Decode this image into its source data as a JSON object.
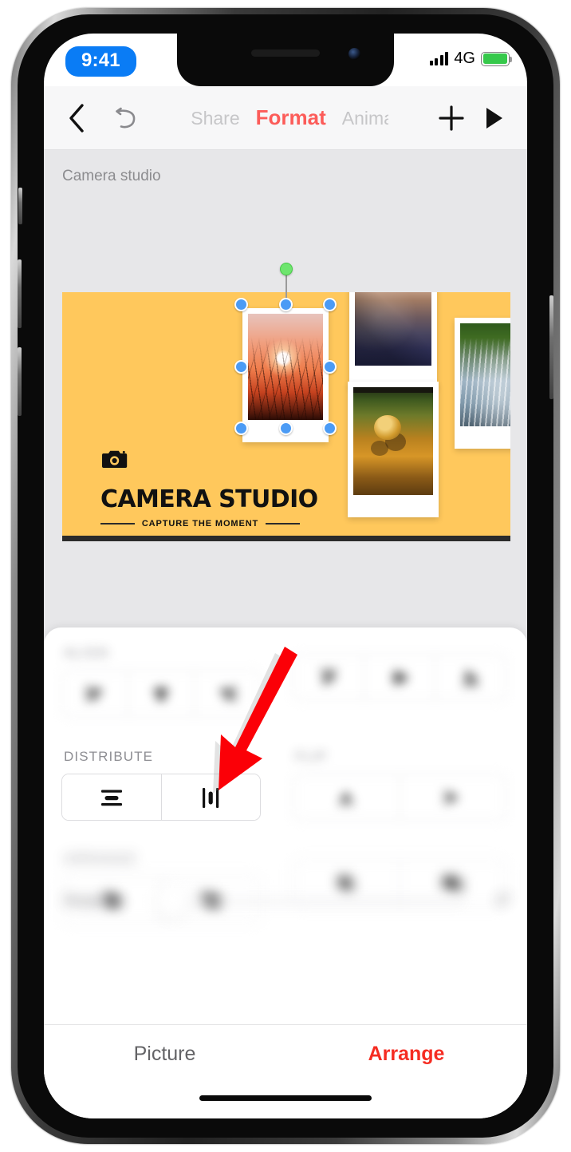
{
  "status_bar": {
    "time": "9:41",
    "network": "4G",
    "signal_icon": "signal-bars-icon",
    "battery_icon": "battery-full-icon"
  },
  "toolbar": {
    "back_icon": "chevron-left-icon",
    "undo_icon": "undo-arrow-icon",
    "add_icon": "plus-icon",
    "play_icon": "play-triangle-icon",
    "tabs": [
      {
        "label": "Share",
        "active": false
      },
      {
        "label": "Format",
        "active": true
      },
      {
        "label": "Animat",
        "active": false
      }
    ]
  },
  "canvas": {
    "document_name": "Camera studio",
    "slide": {
      "background_color": "#FFC85C",
      "title": "CAMERA STUDIO",
      "subtitle": "CAPTURE THE MOMENT",
      "logo_icon": "camera-icon",
      "photos": [
        {
          "name": "sunset-grass-photo",
          "selected": true
        },
        {
          "name": "mountain-photo",
          "selected": false
        },
        {
          "name": "spider-photo",
          "selected": false
        },
        {
          "name": "waterfall-photo",
          "selected": false
        }
      ]
    },
    "selection": {
      "rotation_handle_color": "#6ee56e",
      "handle_color": "#4b9bf5",
      "handle_count": 8
    }
  },
  "panel": {
    "sections": [
      {
        "label": "ALIGN",
        "blurred": true,
        "buttons": [
          {
            "icon": "align-left-icon"
          },
          {
            "icon": "align-center-horizontal-icon"
          },
          {
            "icon": "align-right-icon"
          }
        ]
      },
      {
        "label": "",
        "blurred": true,
        "buttons": [
          {
            "icon": "align-top-icon"
          },
          {
            "icon": "align-middle-vertical-icon"
          },
          {
            "icon": "align-bottom-icon"
          }
        ]
      },
      {
        "label": "DISTRIBUTE",
        "blurred": false,
        "buttons": [
          {
            "icon": "distribute-horizontally-icon"
          },
          {
            "icon": "distribute-vertically-icon"
          }
        ]
      },
      {
        "label": "FLIP",
        "blurred": true,
        "buttons": [
          {
            "icon": "flip-vertical-icon"
          },
          {
            "icon": "flip-horizontal-icon"
          }
        ]
      },
      {
        "label": "ARRANGE",
        "blurred": true,
        "buttons": [
          {
            "icon": "send-backward-icon"
          },
          {
            "icon": "send-to-back-icon"
          }
        ]
      },
      {
        "label": "",
        "blurred": true,
        "buttons": [
          {
            "icon": "bring-forward-icon"
          },
          {
            "icon": "bring-to-front-icon"
          }
        ]
      }
    ],
    "rotation": {
      "label": "Rotation",
      "value": "0°",
      "slider_position_percent": 0
    },
    "tabs": [
      {
        "label": "Picture",
        "active": false
      },
      {
        "label": "Arrange",
        "active": true
      }
    ]
  },
  "annotation": {
    "arrow_color": "#fb0007",
    "points_at": "distribute-horizontally-button"
  }
}
